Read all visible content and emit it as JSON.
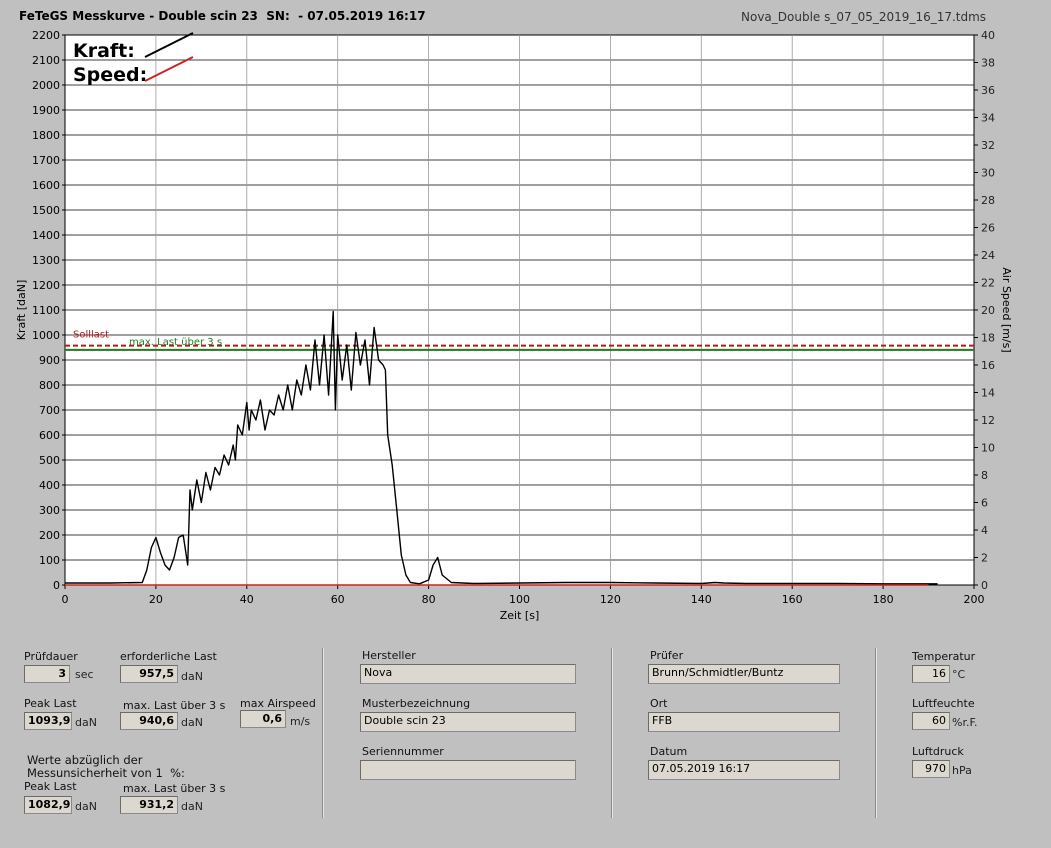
{
  "header": {
    "title": "FeTeGS Messkurve - Double scin 23  SN:  - 07.05.2019 16:17",
    "filename": "Nova_Double s_07_05_2019_16_17.tdms"
  },
  "chart_data": {
    "type": "line",
    "xlabel": "Zeit [s]",
    "ylabel_left": "Kraft [daN]",
    "ylabel_right": "Air Speed [m/s]",
    "xlim": [
      0,
      200
    ],
    "ylim_left": [
      0,
      2200
    ],
    "ylim_right": [
      0,
      40
    ],
    "xticks": [
      "0",
      "20",
      "40",
      "60",
      "80",
      "100",
      "120",
      "140",
      "160",
      "180",
      "200"
    ],
    "yticks_left": [
      "0",
      "100",
      "200",
      "300",
      "400",
      "500",
      "600",
      "700",
      "800",
      "900",
      "1000",
      "1100",
      "1200",
      "1300",
      "1400",
      "1500",
      "1600",
      "1700",
      "1800",
      "1900",
      "2000",
      "2100",
      "2200"
    ],
    "yticks_right": [
      "0",
      "2",
      "4",
      "6",
      "8",
      "10",
      "12",
      "14",
      "16",
      "18",
      "20",
      "22",
      "24",
      "26",
      "28",
      "30",
      "32",
      "34",
      "36",
      "38",
      "40"
    ],
    "grid": true,
    "legend": [
      {
        "label": "Kraft:",
        "color": "#000000"
      },
      {
        "label": "Speed:",
        "color": "#d42020"
      }
    ],
    "reference_lines": [
      {
        "label": "Solllast",
        "value": 957.5,
        "color": "#b01c1c",
        "style": "dashed"
      },
      {
        "label": "max. Last über  3 s",
        "value": 940.6,
        "color": "#1f7a1f",
        "style": "solid"
      }
    ],
    "series": [
      {
        "name": "Kraft",
        "color": "#000000",
        "axis": "left",
        "x": [
          0,
          10,
          17,
          18,
          19,
          20,
          21,
          22,
          23,
          24,
          25,
          26,
          27,
          27.5,
          28,
          29,
          30,
          31,
          32,
          33,
          34,
          35,
          36,
          37,
          37.5,
          38,
          39,
          40,
          40.5,
          41,
          42,
          43,
          44,
          45,
          46,
          47,
          48,
          49,
          50,
          51,
          52,
          53,
          54,
          55,
          56,
          57,
          58,
          59,
          59.5,
          60,
          61,
          62,
          63,
          64,
          65,
          66,
          67,
          68,
          69,
          70,
          70.5,
          71,
          72,
          73,
          74,
          75,
          76,
          78,
          80,
          81,
          82,
          83,
          85,
          90,
          100,
          110,
          120,
          130,
          140,
          143,
          145,
          150,
          160,
          170,
          180,
          190,
          192
        ],
        "y": [
          8,
          8,
          10,
          60,
          150,
          190,
          130,
          80,
          60,
          110,
          190,
          200,
          80,
          380,
          300,
          420,
          330,
          450,
          380,
          470,
          440,
          520,
          480,
          560,
          500,
          640,
          600,
          730,
          620,
          700,
          660,
          740,
          620,
          700,
          680,
          760,
          700,
          800,
          700,
          820,
          760,
          880,
          780,
          980,
          800,
          1000,
          760,
          1093.9,
          700,
          1000,
          820,
          960,
          780,
          1010,
          880,
          980,
          800,
          1030,
          900,
          880,
          860,
          600,
          480,
          300,
          120,
          40,
          10,
          5,
          20,
          80,
          110,
          40,
          10,
          6,
          8,
          10,
          10,
          8,
          6,
          10,
          8,
          6,
          6,
          6,
          5,
          5,
          5
        ]
      },
      {
        "name": "Speed",
        "color": "#d42020",
        "axis": "right",
        "x": [
          0,
          190
        ],
        "y": [
          0,
          0
        ]
      }
    ]
  },
  "fields": {
    "pruefdauer": {
      "label": "Prüfdauer",
      "value": "3",
      "unit": "sec"
    },
    "erforderliche_last": {
      "label": "erforderliche Last",
      "value": "957,5",
      "unit": "daN"
    },
    "peak_last": {
      "label": "Peak Last",
      "value": "1093,9",
      "unit": "daN"
    },
    "max_last": {
      "label": "max. Last über  3 s",
      "value": "940,6",
      "unit": "daN"
    },
    "max_airspeed": {
      "label": "max Airspeed",
      "value": "0,6",
      "unit": "m/s"
    },
    "werte_note": "Werte abzüglich der\nMessunsicherheit von 1  %:",
    "peak_last_korr": {
      "label": "Peak Last",
      "value": "1082,9",
      "unit": "daN"
    },
    "max_last_korr": {
      "label": "max. Last über  3 s",
      "value": "931,2",
      "unit": "daN"
    },
    "hersteller": {
      "label": "Hersteller",
      "value": "Nova"
    },
    "musterbezeichnung": {
      "label": "Musterbezeichnung",
      "value": "Double scin 23"
    },
    "seriennummer": {
      "label": "Seriennummer",
      "value": ""
    },
    "pruefer": {
      "label": "Prüfer",
      "value": "Brunn/Schmidtler/Buntz"
    },
    "ort": {
      "label": "Ort",
      "value": "FFB"
    },
    "datum": {
      "label": "Datum",
      "value": "07.05.2019 16:17"
    },
    "temperatur": {
      "label": "Temperatur",
      "value": "16",
      "unit": "°C"
    },
    "luftfeuchte": {
      "label": "Luftfeuchte",
      "value": "60",
      "unit": "%r.F."
    },
    "luftdruck": {
      "label": "Luftdruck",
      "value": "970",
      "unit": "hPa"
    }
  },
  "colors": {
    "background": "#c0c0c0",
    "plot_background": "#ffffff",
    "kraft": "#000000",
    "speed": "#d42020",
    "solllast": "#b01c1c",
    "maxlast": "#1f7a1f"
  }
}
